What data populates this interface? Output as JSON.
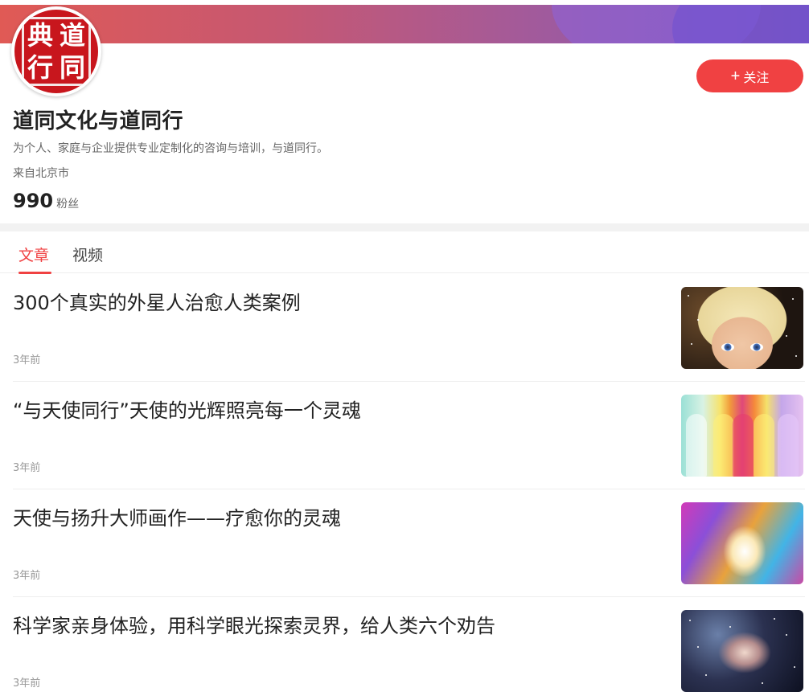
{
  "header": {
    "colors": {
      "banner_start": "#e05a55",
      "banner_end": "#7a57c0",
      "accent": "#f04142"
    },
    "avatar": {
      "seal_chars": [
        "典",
        "道",
        "同",
        "行"
      ]
    },
    "follow_label": "关注",
    "follow_icon": "plus-icon"
  },
  "profile": {
    "name": "道同文化与道同行",
    "description": "为个人、家庭与企业提供专业定制化的咨询与培训，与道同行。",
    "location": "来自北京市",
    "fans_count": "990",
    "fans_label": "粉丝"
  },
  "tabs": [
    {
      "label": "文章",
      "active": true
    },
    {
      "label": "视频",
      "active": false
    }
  ],
  "feed": [
    {
      "title": "300个真实的外星人治愈人类案例",
      "time": "3年前"
    },
    {
      "title": "“与天使同行”天使的光辉照亮每一个灵魂",
      "time": "3年前"
    },
    {
      "title": "天使与扬升大师画作——疗愈你的灵魂",
      "time": "3年前"
    },
    {
      "title": "科学家亲身体验，用科学眼光探索灵界，给人类六个劝告",
      "time": "3年前"
    }
  ]
}
